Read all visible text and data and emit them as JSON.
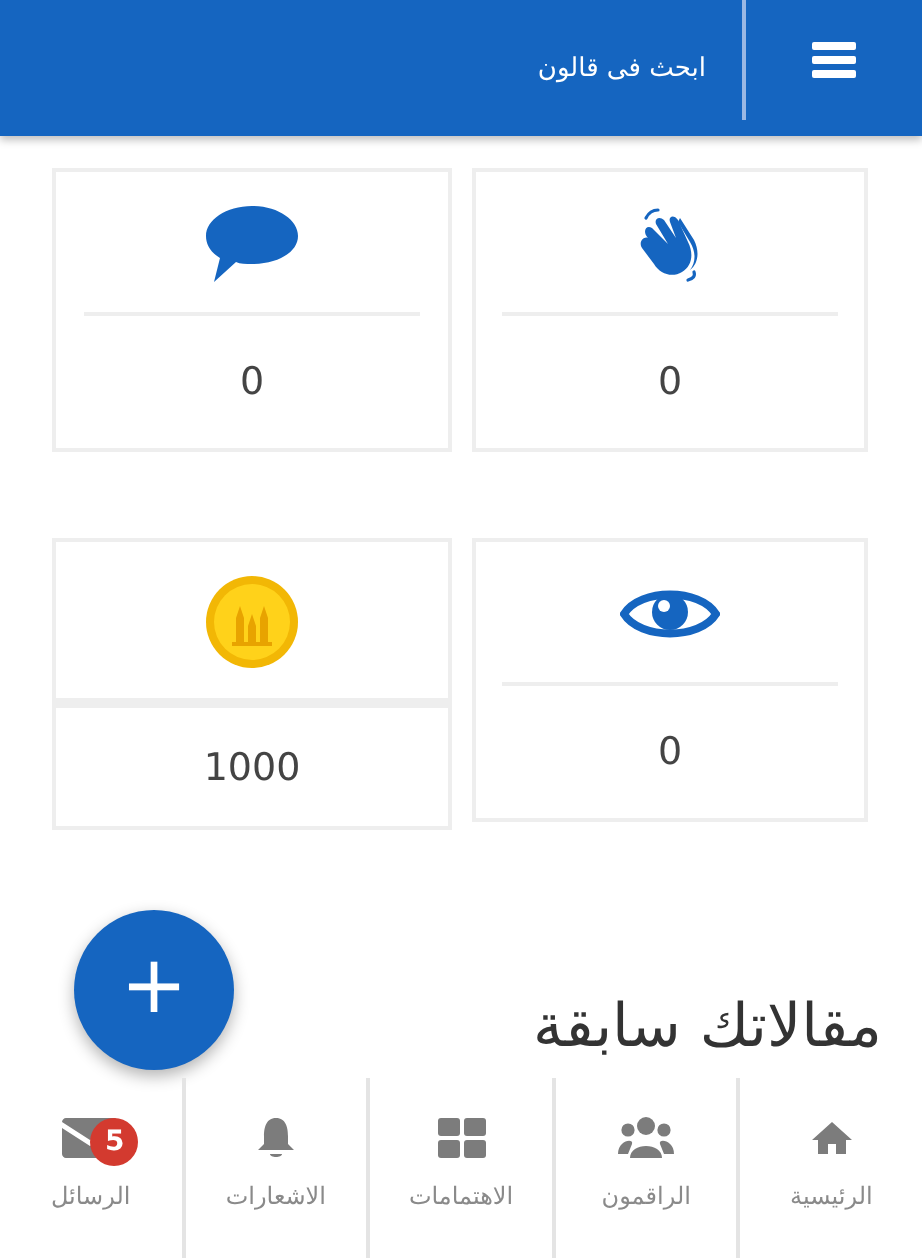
{
  "header": {
    "search_label": "ابحث فى قالون"
  },
  "stats": [
    {
      "kind": "claps",
      "value": "0"
    },
    {
      "kind": "comments",
      "value": "0"
    },
    {
      "kind": "views",
      "value": "0"
    },
    {
      "kind": "coins",
      "value": "1000"
    }
  ],
  "section_title": "مقالاتك سابقة",
  "fab": {
    "label": "+"
  },
  "nav": [
    {
      "kind": "home",
      "label": "الرئيسية"
    },
    {
      "kind": "people",
      "label": "الراقمون"
    },
    {
      "kind": "grid",
      "label": "الاهتمامات"
    },
    {
      "kind": "bell",
      "label": "الاشعارات"
    },
    {
      "kind": "mail",
      "label": "الرسائل",
      "badge": "5"
    }
  ]
}
